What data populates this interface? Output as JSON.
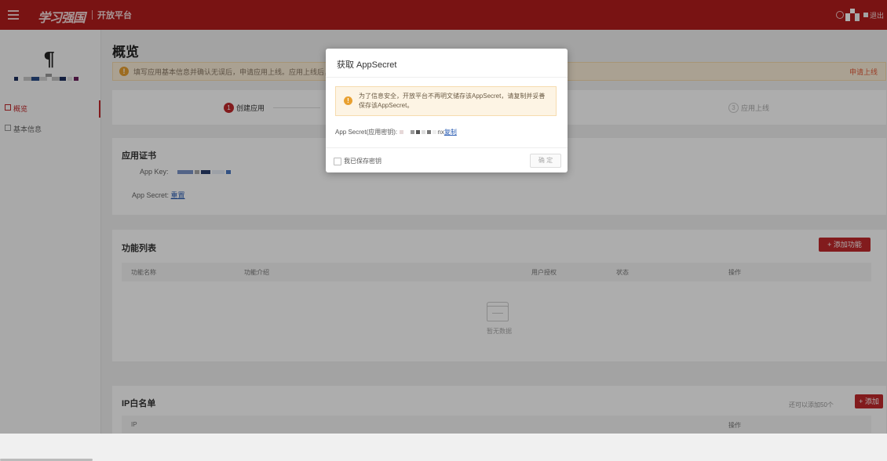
{
  "header": {
    "logo_text": "学习强国",
    "platform_label": "开放平台",
    "logout_label": "退出"
  },
  "sidebar": {
    "items": [
      {
        "label": "概览",
        "active": true
      },
      {
        "label": "基本信息",
        "active": false
      }
    ]
  },
  "main": {
    "page_title": "概览",
    "notice": {
      "text": "填写应用基本信息并确认无误后，申请应用上线。应用上线后，可自",
      "action": "申请上线"
    },
    "steps": [
      {
        "num": "1",
        "label": "创建应用"
      },
      {
        "num": "3",
        "label": "应用上线"
      }
    ],
    "cert": {
      "title": "应用证书",
      "app_key_label": "App Key:",
      "app_secret_label": "App Secret:",
      "reset_link": "重置"
    },
    "func_list": {
      "title": "功能列表",
      "add_button": "+ 添加功能",
      "columns": [
        "功能名称",
        "功能介绍",
        "用户授权",
        "状态",
        "操作"
      ],
      "empty_text": "暂无数据"
    },
    "ip_whitelist": {
      "title": "IP白名单",
      "hint": "还可以添加50个",
      "add_button": "+ 添加",
      "columns": [
        "IP",
        "操作"
      ]
    }
  },
  "modal": {
    "title": "获取 AppSecret",
    "warning": "为了信息安全，开放平台不再明文储存该AppSecret，请复制并妥善保存该AppSecret。",
    "secret_label": "App Secret(应用密钥):",
    "secret_suffix": "nx",
    "copy_link": "复制",
    "checkbox_label": "我已保存密钥",
    "confirm_button": "确 定"
  },
  "colors": {
    "brand_red": "#b31d1d",
    "accent_red": "#c0282b",
    "link_blue": "#2b5db3",
    "warning_orange": "#e8a030"
  },
  "icons": [
    "menu-icon",
    "search-icon",
    "avatar-icon",
    "app-icon",
    "overview-icon",
    "info-icon",
    "warning-icon",
    "empty-inbox-icon"
  ]
}
